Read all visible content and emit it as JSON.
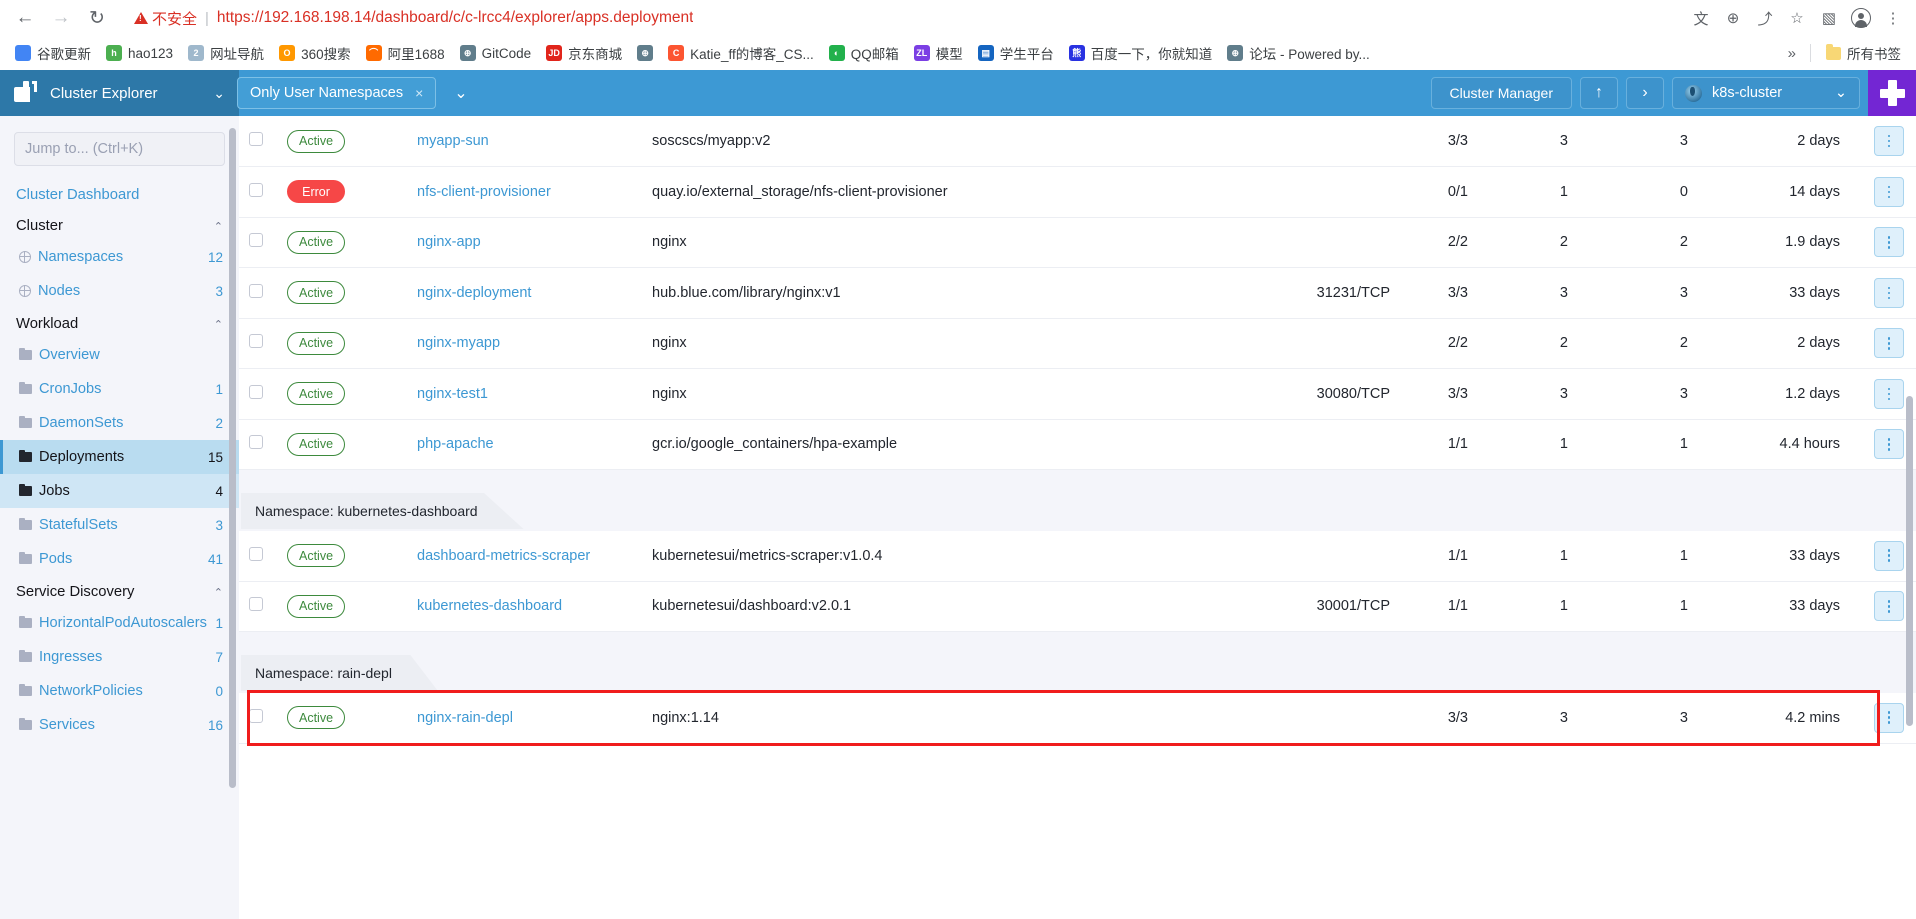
{
  "browser": {
    "nav": {
      "back_label": "←",
      "forward_label": "→",
      "reload_label": "↻"
    },
    "omnibox": {
      "security_label": "不安全",
      "separator": "|",
      "url": "https://192.168.198.14/dashboard/c/c-lrcc4/explorer/apps.deployment",
      "translate_label": "文",
      "zoom_label": "⊕",
      "share_label": "⤴",
      "bookmark_label": "☆",
      "sidepanel_label": "▧",
      "menu_label": "⋮"
    },
    "bookmarks": [
      {
        "label": "谷歌更新",
        "icon": "chrome-icon",
        "glyph": "",
        "color": "#4285f4"
      },
      {
        "label": "hao123",
        "icon": "hao123-icon",
        "glyph": "h",
        "color": "#4caf50"
      },
      {
        "label": "网址导航",
        "icon": "nav-icon",
        "glyph": "2",
        "color": "#9fb8cc"
      },
      {
        "label": "360搜索",
        "icon": "360-icon",
        "glyph": "O",
        "color": "#ff9800"
      },
      {
        "label": "阿里1688",
        "icon": "alibaba-icon",
        "glyph": "⌒",
        "color": "#ff6a00"
      },
      {
        "label": "GitCode",
        "icon": "gitcode-icon",
        "glyph": "⊕",
        "color": "#607d8b"
      },
      {
        "label": "京东商城",
        "icon": "jd-icon",
        "glyph": "JD",
        "color": "#e1251b"
      },
      {
        "label": "",
        "icon": "globe-icon",
        "glyph": "⊕",
        "color": "#607d8b"
      },
      {
        "label": "Katie_ff的博客_CS...",
        "icon": "csdn-icon",
        "glyph": "C",
        "color": "#fc5531"
      },
      {
        "label": "QQ邮箱",
        "icon": "qqmail-icon",
        "glyph": "◐",
        "color": "#22b14c"
      },
      {
        "label": "模型",
        "icon": "zl-icon",
        "glyph": "ZL",
        "color": "#7b3fe4"
      },
      {
        "label": "学生平台",
        "icon": "student-icon",
        "glyph": "▤",
        "color": "#1565c0"
      },
      {
        "label": "百度一下，你就知道",
        "icon": "baidu-icon",
        "glyph": "熊",
        "color": "#2932e1"
      },
      {
        "label": "论坛 - Powered by...",
        "icon": "globe-icon",
        "glyph": "⊕",
        "color": "#607d8b"
      }
    ],
    "bookmarks_overflow_label": "»",
    "all_bookmarks_label": "所有书签"
  },
  "topbar": {
    "brand_label": "Cluster Explorer",
    "brand_chevron": "⌄",
    "namespace_filter": {
      "label": "Only User Namespaces",
      "remove_label": "×",
      "dropdown_chevron": "⌄"
    },
    "cluster_manager_label": "Cluster Manager",
    "import_yaml_label": "↑",
    "shell_label": "›",
    "cluster_name": "k8s-cluster",
    "cluster_chevron": "⌄",
    "extension_label": "+"
  },
  "sidebar": {
    "search_placeholder": "Jump to... (Ctrl+K)",
    "search_value": "",
    "dashboard_label": "Cluster Dashboard",
    "groups": [
      {
        "title": "Cluster",
        "chevron": "⌃",
        "items": [
          {
            "label": "Namespaces",
            "count": "12",
            "icon": "globe-icon",
            "state": ""
          },
          {
            "label": "Nodes",
            "count": "3",
            "icon": "globe-icon",
            "state": ""
          }
        ]
      },
      {
        "title": "Workload",
        "chevron": "⌃",
        "items": [
          {
            "label": "Overview",
            "count": "",
            "icon": "folder-icon",
            "state": ""
          },
          {
            "label": "CronJobs",
            "count": "1",
            "icon": "folder-icon",
            "state": ""
          },
          {
            "label": "DaemonSets",
            "count": "2",
            "icon": "folder-icon",
            "state": ""
          },
          {
            "label": "Deployments",
            "count": "15",
            "icon": "folder-icon",
            "state": "active"
          },
          {
            "label": "Jobs",
            "count": "4",
            "icon": "folder-icon",
            "state": "active2"
          },
          {
            "label": "StatefulSets",
            "count": "3",
            "icon": "folder-icon",
            "state": ""
          },
          {
            "label": "Pods",
            "count": "41",
            "icon": "folder-icon",
            "state": ""
          }
        ]
      },
      {
        "title": "Service Discovery",
        "chevron": "⌃",
        "items": [
          {
            "label": "HorizontalPodAutoscalers",
            "count": "1",
            "icon": "folder-icon",
            "state": ""
          },
          {
            "label": "Ingresses",
            "count": "7",
            "icon": "folder-icon",
            "state": ""
          },
          {
            "label": "NetworkPolicies",
            "count": "0",
            "icon": "folder-icon",
            "state": ""
          },
          {
            "label": "Services",
            "count": "16",
            "icon": "folder-icon",
            "state": ""
          }
        ]
      }
    ]
  },
  "table": {
    "rows": [
      {
        "kind": "row",
        "state": "Active",
        "state_type": "active",
        "name": "myapp-sun",
        "image": "soscscs/myapp:v2",
        "ports": "",
        "ready": "3/3",
        "up_to_date": "3",
        "available": "3",
        "age": "2 days"
      },
      {
        "kind": "row",
        "state": "Error",
        "state_type": "error",
        "name": "nfs-client-provisioner",
        "image": "quay.io/external_storage/nfs-client-provisioner",
        "ports": "",
        "ready": "0/1",
        "up_to_date": "1",
        "available": "0",
        "age": "14 days"
      },
      {
        "kind": "row",
        "state": "Active",
        "state_type": "active",
        "name": "nginx-app",
        "image": "nginx",
        "ports": "",
        "ready": "2/2",
        "up_to_date": "2",
        "available": "2",
        "age": "1.9 days"
      },
      {
        "kind": "row",
        "state": "Active",
        "state_type": "active",
        "name": "nginx-deployment",
        "image": "hub.blue.com/library/nginx:v1",
        "ports": "31231/TCP",
        "ready": "3/3",
        "up_to_date": "3",
        "available": "3",
        "age": "33 days"
      },
      {
        "kind": "row",
        "state": "Active",
        "state_type": "active",
        "name": "nginx-myapp",
        "image": "nginx",
        "ports": "",
        "ready": "2/2",
        "up_to_date": "2",
        "available": "2",
        "age": "2 days"
      },
      {
        "kind": "row",
        "state": "Active",
        "state_type": "active",
        "name": "nginx-test1",
        "image": "nginx",
        "ports": "30080/TCP",
        "ready": "3/3",
        "up_to_date": "3",
        "available": "3",
        "age": "1.2 days"
      },
      {
        "kind": "row",
        "state": "Active",
        "state_type": "active",
        "name": "php-apache",
        "image": "gcr.io/google_containers/hpa-example",
        "ports": "",
        "ready": "1/1",
        "up_to_date": "1",
        "available": "1",
        "age": "4.4 hours"
      },
      {
        "kind": "group",
        "label": "Namespace: kubernetes-dashboard"
      },
      {
        "kind": "row",
        "state": "Active",
        "state_type": "active",
        "name": "dashboard-metrics-scraper",
        "image": "kubernetesui/metrics-scraper:v1.0.4",
        "ports": "",
        "ready": "1/1",
        "up_to_date": "1",
        "available": "1",
        "age": "33 days"
      },
      {
        "kind": "row",
        "state": "Active",
        "state_type": "active",
        "name": "kubernetes-dashboard",
        "image": "kubernetesui/dashboard:v2.0.1",
        "ports": "30001/TCP",
        "ready": "1/1",
        "up_to_date": "1",
        "available": "1",
        "age": "33 days"
      },
      {
        "kind": "group",
        "label": "Namespace: rain-depl"
      },
      {
        "kind": "row",
        "state": "Active",
        "state_type": "active",
        "name": "nginx-rain-depl",
        "image": "nginx:1.14",
        "ports": "",
        "ready": "3/3",
        "up_to_date": "3",
        "available": "3",
        "age": "4.2 mins",
        "highlighted": true
      }
    ],
    "action_menu_label": "⋮",
    "highlight_color": "#f01c1c"
  },
  "colors": {
    "brand_blue": "#3d99d4",
    "brand_dark_blue": "#2d78a8",
    "link_blue": "#3d98d3",
    "active_green": "#3d8a3d",
    "error_red": "#f64747",
    "sidebar_bg": "#f4f5fa",
    "highlight_red": "#f01c1c",
    "extension_purple": "#7326d3"
  }
}
